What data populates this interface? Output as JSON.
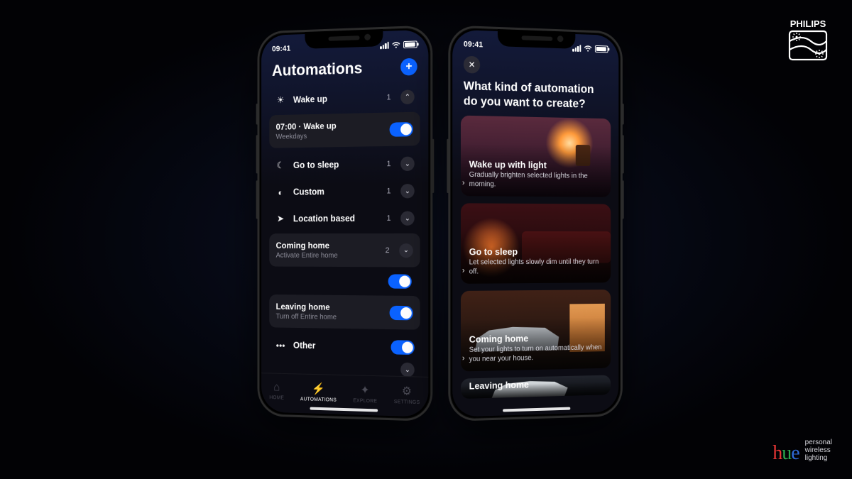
{
  "status": {
    "time": "09:41"
  },
  "left": {
    "title": "Automations",
    "sections": {
      "wake": {
        "label": "Wake up",
        "count": "1"
      },
      "sleep": {
        "label": "Go to sleep",
        "count": "1"
      },
      "custom": {
        "label": "Custom",
        "count": "1"
      },
      "location": {
        "label": "Location based",
        "count": "1"
      },
      "other": {
        "label": "Other"
      }
    },
    "wake_item": {
      "title": "07:00 · Wake up",
      "sub": "Weekdays"
    },
    "loc_count": "2",
    "coming_home": {
      "title": "Coming home",
      "sub": "Activate Entire home"
    },
    "leaving_home": {
      "title": "Leaving home",
      "sub": "Turn off Entire home"
    },
    "tabs": {
      "home": "HOME",
      "automations": "AUTOMATIONS",
      "explore": "EXPLORE",
      "settings": "SETTINGS"
    }
  },
  "right": {
    "title": "What kind of automation do you want to create?",
    "options": {
      "wake": {
        "title": "Wake up with light",
        "desc": "Gradually brighten selected lights in the morning."
      },
      "sleep": {
        "title": "Go to sleep",
        "desc": "Let selected lights slowly dim until they turn off."
      },
      "home": {
        "title": "Coming home",
        "desc": "Set your lights to turn on automatically when you near your house."
      },
      "leave": {
        "title": "Leaving home",
        "desc": ""
      }
    }
  },
  "brand": {
    "philips": "PHILIPS",
    "hue_tag": "personal\nwireless\nlighting"
  }
}
